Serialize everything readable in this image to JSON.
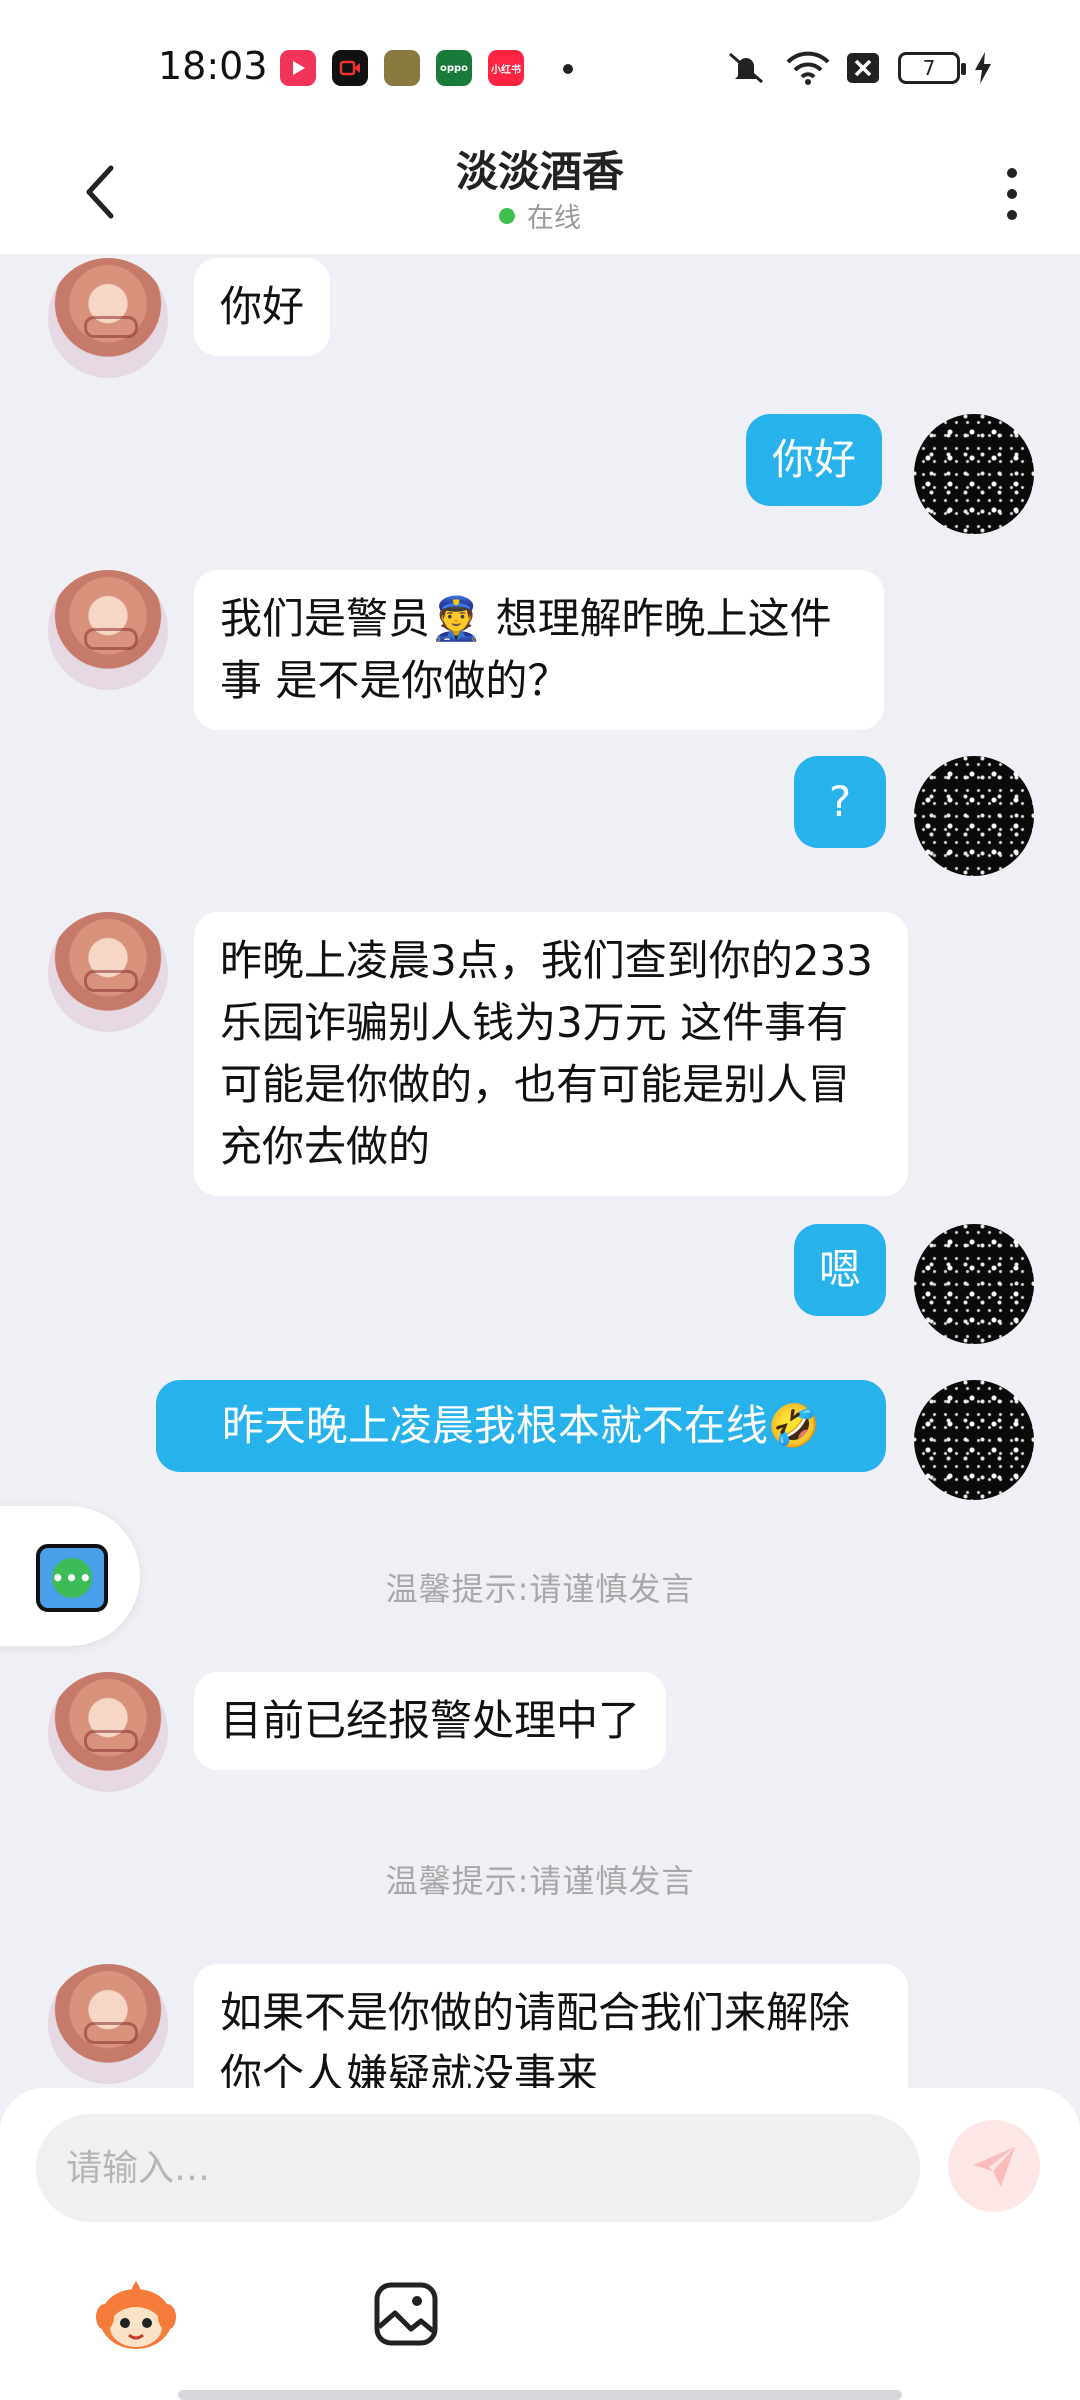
{
  "status_bar": {
    "time": "18:03",
    "app_icons": [
      {
        "name": "video-app-icon",
        "color": "#f0345a"
      },
      {
        "name": "recorder-app-icon",
        "color": "#111111"
      },
      {
        "name": "game-app-icon",
        "color": "#7a6b3a"
      },
      {
        "name": "oppo-app-icon",
        "color": "#1a7a3c",
        "label": "oppo"
      },
      {
        "name": "xiaohongshu-app-icon",
        "color": "#ff2442",
        "label": "小红书"
      }
    ],
    "battery_level": "7"
  },
  "header": {
    "title": "淡淡酒香",
    "status": "在线"
  },
  "messages": [
    {
      "side": "in",
      "text": "你好"
    },
    {
      "side": "out",
      "text": "你好"
    },
    {
      "side": "in",
      "text": "我们是警员👮 想理解昨晚上这件事 是不是你做的？"
    },
    {
      "side": "out",
      "text": "?"
    },
    {
      "side": "in",
      "text": "昨晚上凌晨3点，我们查到你的233乐园诈骗别人钱为3万元 这件事有可能是你做的，也有可能是别人冒充你去做的"
    },
    {
      "side": "out",
      "text": "嗯"
    },
    {
      "side": "out",
      "text": "昨天晚上凌晨我根本就不在线🤣"
    },
    {
      "side": "hint",
      "text": "温馨提示:请谨慎发言"
    },
    {
      "side": "in",
      "text": "目前已经报警处理中了"
    },
    {
      "side": "hint",
      "text": "温馨提示:请谨慎发言"
    },
    {
      "side": "in",
      "text": "如果不是你做的请配合我们来解除你个人嫌疑就没事来"
    }
  ],
  "input": {
    "placeholder": "请输入…",
    "value": ""
  },
  "float_button": {
    "label": "•••"
  },
  "colors": {
    "outgoing_bubble": "#27b2ec",
    "incoming_bubble": "#ffffff",
    "chat_background": "#eef0f5",
    "online": "#3fbf4f"
  }
}
